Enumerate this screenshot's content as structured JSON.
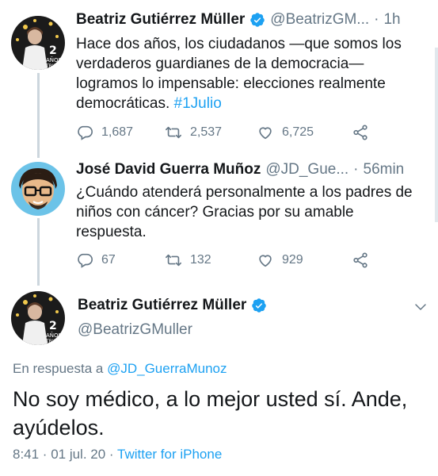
{
  "thread": {
    "tweet1": {
      "name": "Beatriz Gutiérrez Müller",
      "handle": "@BeatrizGM...",
      "sep": "·",
      "time": "1h",
      "text_lines": [
        "Hace dos años, los ciudadanos —que somos los",
        "verdaderos guardianes de la democracia—",
        "logramos lo impensable: elecciones realmente",
        "democráticas. "
      ],
      "hashtag": "#1Julio",
      "replies": "1,687",
      "retweets": "2,537",
      "likes": "6,725"
    },
    "tweet2": {
      "name": "José David Guerra Muñoz",
      "handle": "@JD_Gue...",
      "sep": "·",
      "time": "56min",
      "text_lines": [
        "¿Cuándo atenderá personalmente a los padres de",
        "niños con cáncer? Gracias por su amable",
        "respuesta."
      ],
      "replies": "67",
      "retweets": "132",
      "likes": "929"
    }
  },
  "focused": {
    "name": "Beatriz Gutiérrez Müller",
    "handle": "@BeatrizGMuller",
    "reply_prefix": "En respuesta a ",
    "reply_mention": "@JD_GuerraMunoz",
    "text_lines": [
      "No soy médico, a lo mejor usted sí. Ande,",
      "ayúdelos."
    ],
    "timestamp": "8:41 · 01 jul. 20 · ",
    "source": "Twitter for iPhone"
  },
  "colors": {
    "accent": "#1da1f2",
    "muted": "#657786",
    "text": "#14171a",
    "verified": "#1da1f2"
  },
  "icons": [
    "verified-badge-icon",
    "reply-icon",
    "retweet-icon",
    "like-icon",
    "share-icon",
    "chevron-down-icon"
  ]
}
